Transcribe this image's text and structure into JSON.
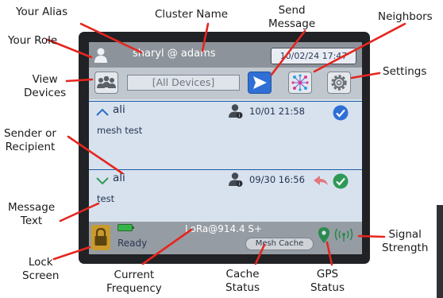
{
  "annotations": {
    "your_alias": "Your Alias",
    "cluster_name": "Cluster Name",
    "send_message": [
      "Send",
      "Message"
    ],
    "neighbors": "Neighbors",
    "your_role": "Your Role",
    "view_devices": [
      "View",
      "Devices"
    ],
    "settings": "Settings",
    "sender_or_recipient": [
      "Sender or",
      "Recipient"
    ],
    "message_text": [
      "Message",
      "Text"
    ],
    "lock_screen": [
      "Lock",
      "Screen"
    ],
    "current_frequency": [
      "Current",
      "Frequency"
    ],
    "cache_status": [
      "Cache",
      "Status"
    ],
    "gps_status": [
      "GPS",
      "Status"
    ],
    "signal_strength": [
      "Signal",
      "Strength"
    ]
  },
  "device": {
    "top_bar": {
      "role_icon": "person-icon",
      "alias_cluster": "sharyl @ adams",
      "datetime": "10/02/24 17:47"
    },
    "toolbar": {
      "view_devices_icon": "people-icon",
      "recipient_field": "[All Devices]",
      "send_icon": "send-arrow-icon",
      "neighbors_icon": "network-icon",
      "settings_icon": "gear-icon"
    },
    "messages": [
      {
        "direction": "outgoing",
        "sender": "ali",
        "time": "10/01 21:58",
        "text": "mesh test",
        "status_icon": "check-circle-icon",
        "status_color": "#2f6fd6"
      },
      {
        "direction": "incoming",
        "sender": "ali",
        "time": "09/30 16:56",
        "text": "test",
        "status_icon": "check-circle-icon",
        "status_color": "#2e9a57",
        "reply_icon": "reply-arrow-icon"
      }
    ],
    "status_bar": {
      "lock_icon": "lock-icon",
      "battery_icon": "battery-icon",
      "frequency": "LoRa@914.4 S+",
      "state": "Ready",
      "cache": "Mesh Cache",
      "gps_icon": "map-pin-icon",
      "signal_icon": "radio-waves-icon"
    }
  },
  "colors": {
    "send_button": "#2f6fd6",
    "reply_arrow": "#e0787d",
    "callout_line": "#e5261f",
    "lock_button": "#c99a2c",
    "battery": "#37b34a"
  }
}
